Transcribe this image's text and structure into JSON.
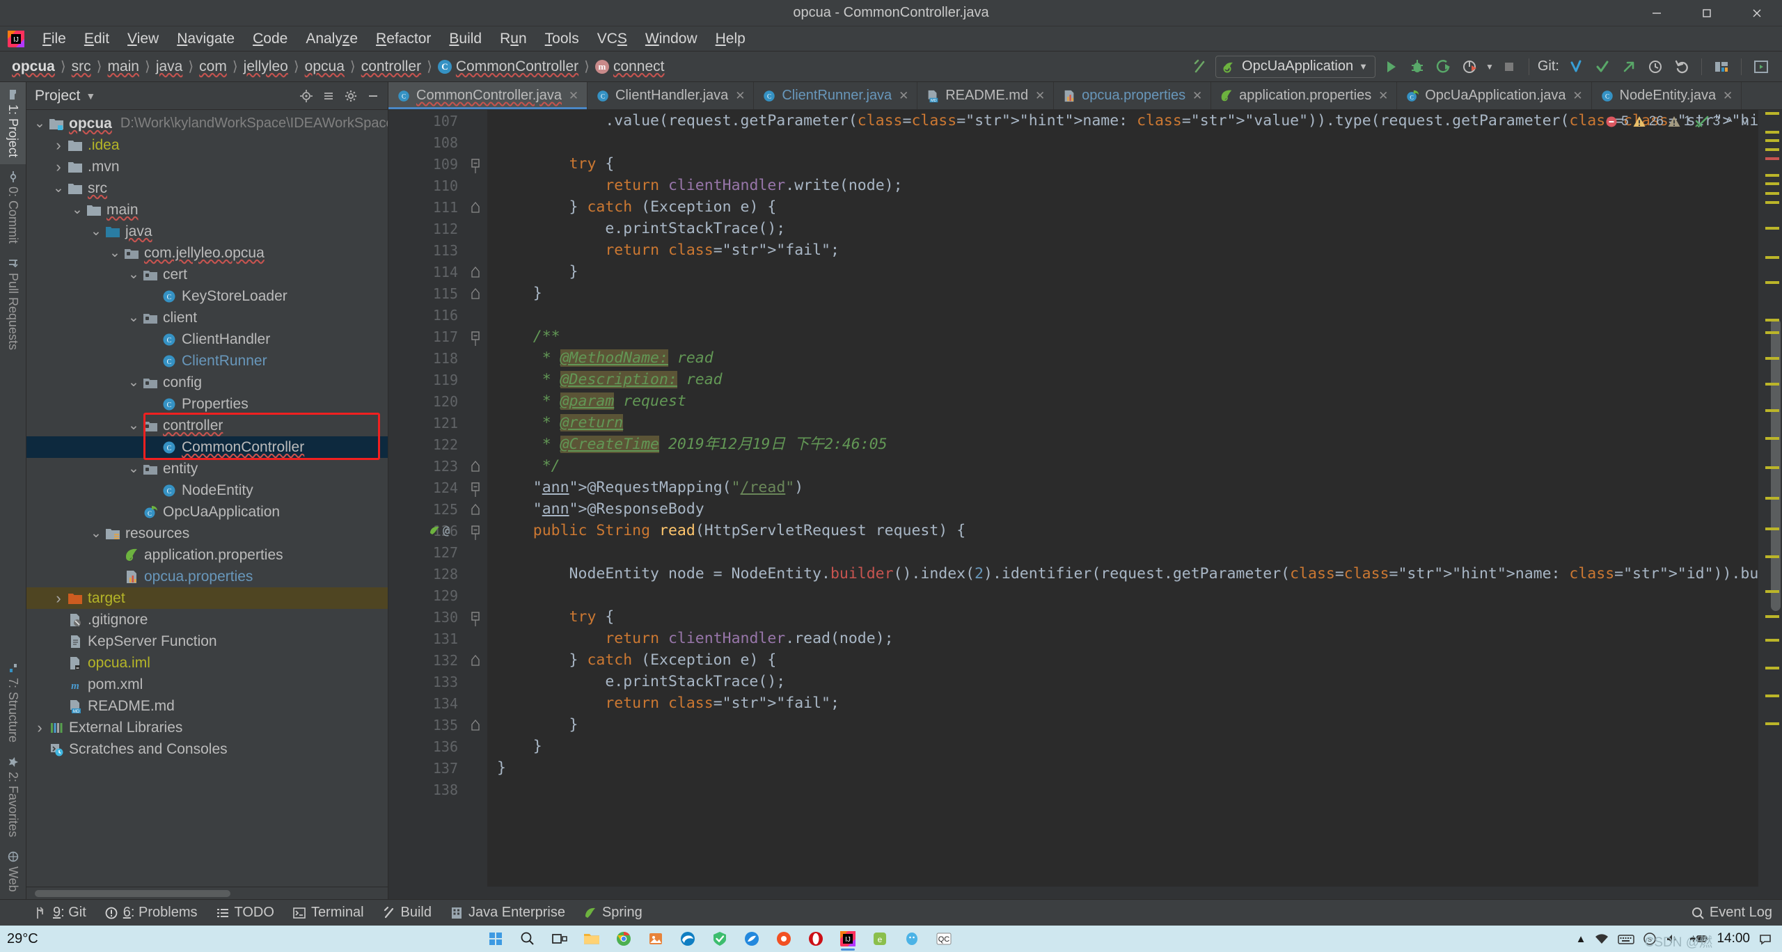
{
  "window": {
    "title": "opcua - CommonController.java",
    "minimize": "─",
    "maximize": "☐",
    "close": "✕"
  },
  "menu": {
    "items": [
      {
        "label": "File",
        "mnemonic": "F"
      },
      {
        "label": "Edit",
        "mnemonic": "E"
      },
      {
        "label": "View",
        "mnemonic": "V"
      },
      {
        "label": "Navigate",
        "mnemonic": "N"
      },
      {
        "label": "Code",
        "mnemonic": "C"
      },
      {
        "label": "Analyze",
        "mnemonic": "z"
      },
      {
        "label": "Refactor",
        "mnemonic": "R"
      },
      {
        "label": "Build",
        "mnemonic": "B"
      },
      {
        "label": "Run",
        "mnemonic": "u"
      },
      {
        "label": "Tools",
        "mnemonic": "T"
      },
      {
        "label": "VCS",
        "mnemonic": "S"
      },
      {
        "label": "Window",
        "mnemonic": "W"
      },
      {
        "label": "Help",
        "mnemonic": "H"
      }
    ]
  },
  "breadcrumbs": [
    {
      "label": "opcua",
      "bold": true,
      "spell": true,
      "icon": ""
    },
    {
      "label": "src",
      "bold": false,
      "spell": true,
      "icon": ""
    },
    {
      "label": "main",
      "bold": false,
      "spell": true,
      "icon": ""
    },
    {
      "label": "java",
      "bold": false,
      "spell": true,
      "icon": ""
    },
    {
      "label": "com",
      "bold": false,
      "spell": true,
      "icon": ""
    },
    {
      "label": "jellyleo",
      "bold": false,
      "spell": true,
      "icon": ""
    },
    {
      "label": "opcua",
      "bold": false,
      "spell": true,
      "icon": ""
    },
    {
      "label": "controller",
      "bold": false,
      "spell": true,
      "icon": ""
    },
    {
      "label": "CommonController",
      "bold": false,
      "spell": true,
      "icon": "class"
    },
    {
      "label": "connect",
      "bold": false,
      "spell": true,
      "icon": "method"
    }
  ],
  "toolbar": {
    "run_configuration": "OpcUaApplication",
    "git_label": "Git:",
    "icons": [
      "run-icon",
      "debug-icon",
      "run-with-coverage-icon",
      "profiler-icon",
      "stop-icon",
      "git-update-icon",
      "git-commit-icon",
      "git-push-icon",
      "git-history-icon",
      "git-rollback-icon",
      "search-everywhere-icon",
      "layout-icon"
    ]
  },
  "sidebar_left": {
    "top": [
      {
        "label": "1: Project",
        "mnemonic": "1",
        "active": true,
        "icon": "project-icon"
      },
      {
        "label": "0: Commit",
        "mnemonic": "0",
        "active": false,
        "icon": "commit-icon"
      },
      {
        "label": "Pull Requests",
        "mnemonic": "",
        "active": false,
        "icon": "pull-request-icon"
      }
    ],
    "bottom": [
      {
        "label": "7: Structure",
        "mnemonic": "7",
        "active": false,
        "icon": "structure-icon"
      },
      {
        "label": "2: Favorites",
        "mnemonic": "2",
        "active": false,
        "icon": "star-icon"
      },
      {
        "label": "Web",
        "mnemonic": "",
        "active": false,
        "icon": "web-icon"
      }
    ]
  },
  "project_panel": {
    "title": "Project",
    "header_icons": [
      "target-icon",
      "collapse-all-icon",
      "settings-gear-icon",
      "hide-icon"
    ],
    "tree": [
      {
        "depth": 0,
        "arrow": "down",
        "icon": "module-folder",
        "label": "opcua",
        "path": "D:\\Work\\kylandWorkSpace\\IDEAWorkSpace\\",
        "style": "bold",
        "spell": true
      },
      {
        "depth": 1,
        "arrow": "right",
        "icon": "folder",
        "label": ".idea",
        "path": "",
        "style": "yellow",
        "spell": false
      },
      {
        "depth": 1,
        "arrow": "right",
        "icon": "folder",
        "label": ".mvn",
        "path": "",
        "style": "",
        "spell": false
      },
      {
        "depth": 1,
        "arrow": "down",
        "icon": "folder",
        "label": "src",
        "path": "",
        "style": "",
        "spell": true
      },
      {
        "depth": 2,
        "arrow": "down",
        "icon": "folder",
        "label": "main",
        "path": "",
        "style": "",
        "spell": true
      },
      {
        "depth": 3,
        "arrow": "down",
        "icon": "source-folder",
        "label": "java",
        "path": "",
        "style": "",
        "spell": true
      },
      {
        "depth": 4,
        "arrow": "down",
        "icon": "package",
        "label": "com.jellyleo.opcua",
        "path": "",
        "style": "",
        "spell": true
      },
      {
        "depth": 5,
        "arrow": "down",
        "icon": "package",
        "label": "cert",
        "path": "",
        "style": "",
        "spell": false
      },
      {
        "depth": 6,
        "arrow": "none",
        "icon": "class",
        "label": "KeyStoreLoader",
        "path": "",
        "style": "",
        "spell": false
      },
      {
        "depth": 5,
        "arrow": "down",
        "icon": "package",
        "label": "client",
        "path": "",
        "style": "",
        "spell": false
      },
      {
        "depth": 6,
        "arrow": "none",
        "icon": "class",
        "label": "ClientHandler",
        "path": "",
        "style": "",
        "spell": false
      },
      {
        "depth": 6,
        "arrow": "none",
        "icon": "class",
        "label": "ClientRunner",
        "path": "",
        "style": "blue",
        "spell": false
      },
      {
        "depth": 5,
        "arrow": "down",
        "icon": "package",
        "label": "config",
        "path": "",
        "style": "",
        "spell": false
      },
      {
        "depth": 6,
        "arrow": "none",
        "icon": "class",
        "label": "Properties",
        "path": "",
        "style": "",
        "spell": false
      },
      {
        "depth": 5,
        "arrow": "down",
        "icon": "package",
        "label": "controller",
        "path": "",
        "style": "",
        "spell": true
      },
      {
        "depth": 6,
        "arrow": "none",
        "icon": "class",
        "label": "CommonController",
        "path": "",
        "style": "",
        "spell": true,
        "selected": true
      },
      {
        "depth": 5,
        "arrow": "down",
        "icon": "package",
        "label": "entity",
        "path": "",
        "style": "",
        "spell": false
      },
      {
        "depth": 6,
        "arrow": "none",
        "icon": "class",
        "label": "NodeEntity",
        "path": "",
        "style": "",
        "spell": false
      },
      {
        "depth": 5,
        "arrow": "none",
        "icon": "spring-class",
        "label": "OpcUaApplication",
        "path": "",
        "style": "",
        "spell": false
      },
      {
        "depth": 3,
        "arrow": "down",
        "icon": "resource-folder",
        "label": "resources",
        "path": "",
        "style": "",
        "spell": false
      },
      {
        "depth": 4,
        "arrow": "none",
        "icon": "spring-props",
        "label": "application.properties",
        "path": "",
        "style": "",
        "spell": false
      },
      {
        "depth": 4,
        "arrow": "none",
        "icon": "properties",
        "label": "opcua.properties",
        "path": "",
        "style": "blue",
        "spell": false
      },
      {
        "depth": 1,
        "arrow": "right",
        "icon": "target-folder",
        "label": "target",
        "path": "",
        "style": "yellow",
        "spell": false,
        "highlight": true
      },
      {
        "depth": 1,
        "arrow": "none",
        "icon": "gitignore",
        "label": ".gitignore",
        "path": "",
        "style": "",
        "spell": false
      },
      {
        "depth": 1,
        "arrow": "none",
        "icon": "text-file",
        "label": "KepServer Function",
        "path": "",
        "style": "",
        "spell": false
      },
      {
        "depth": 1,
        "arrow": "none",
        "icon": "iml-file",
        "label": "opcua.iml",
        "path": "",
        "style": "yellow",
        "spell": false
      },
      {
        "depth": 1,
        "arrow": "none",
        "icon": "maven",
        "label": "pom.xml",
        "path": "",
        "style": "",
        "spell": false
      },
      {
        "depth": 1,
        "arrow": "none",
        "icon": "markdown",
        "label": "README.md",
        "path": "",
        "style": "",
        "spell": false
      },
      {
        "depth": 0,
        "arrow": "right",
        "icon": "libraries",
        "label": "External Libraries",
        "path": "",
        "style": "",
        "spell": false
      },
      {
        "depth": 0,
        "arrow": "none",
        "icon": "scratches",
        "label": "Scratches and Consoles",
        "path": "",
        "style": "",
        "spell": false
      }
    ]
  },
  "editor_tabs": [
    {
      "label": "CommonController.java",
      "icon": "class",
      "active": true,
      "spell": true,
      "blue": false
    },
    {
      "label": "ClientHandler.java",
      "icon": "class",
      "active": false,
      "spell": false,
      "blue": false
    },
    {
      "label": "ClientRunner.java",
      "icon": "class",
      "active": false,
      "spell": false,
      "blue": true
    },
    {
      "label": "README.md",
      "icon": "markdown",
      "active": false,
      "spell": false,
      "blue": false
    },
    {
      "label": "opcua.properties",
      "icon": "properties",
      "active": false,
      "spell": false,
      "blue": true
    },
    {
      "label": "application.properties",
      "icon": "spring-props",
      "active": false,
      "spell": false,
      "blue": false
    },
    {
      "label": "OpcUaApplication.java",
      "icon": "spring-class",
      "active": false,
      "spell": false,
      "blue": false
    },
    {
      "label": "NodeEntity.java",
      "icon": "class",
      "active": false,
      "spell": false,
      "blue": false
    }
  ],
  "editor": {
    "first_line_number": 107,
    "last_line_number": 138,
    "inspections": {
      "errors": "5",
      "warnings": "26",
      "weak_warnings": "1",
      "typos": "3",
      "up_arrow": "⌃",
      "down_arrow": "⌄"
    },
    "code_lines": [
      {
        "n": 107,
        "fold": "",
        "gutter": "",
        "text": "            .value(request.getParameter( name: \"value\")).type(request.getParameter( name: \"type\")).build();"
      },
      {
        "n": 108,
        "fold": "",
        "gutter": "",
        "text": ""
      },
      {
        "n": 109,
        "fold": "open",
        "gutter": "",
        "text": "        try {"
      },
      {
        "n": 110,
        "fold": "",
        "gutter": "",
        "text": "            return clientHandler.write(node);"
      },
      {
        "n": 111,
        "fold": "end",
        "gutter": "",
        "text": "        } catch (Exception e) {"
      },
      {
        "n": 112,
        "fold": "",
        "gutter": "",
        "text": "            e.printStackTrace();"
      },
      {
        "n": 113,
        "fold": "",
        "gutter": "",
        "text": "            return \"fail\";"
      },
      {
        "n": 114,
        "fold": "end",
        "gutter": "",
        "text": "        }"
      },
      {
        "n": 115,
        "fold": "end",
        "gutter": "",
        "text": "    }"
      },
      {
        "n": 116,
        "fold": "",
        "gutter": "",
        "text": ""
      },
      {
        "n": 117,
        "fold": "open",
        "gutter": "",
        "text": "    /**"
      },
      {
        "n": 118,
        "fold": "",
        "gutter": "",
        "text": "     * @MethodName: read"
      },
      {
        "n": 119,
        "fold": "",
        "gutter": "",
        "text": "     * @Description: read"
      },
      {
        "n": 120,
        "fold": "",
        "gutter": "",
        "text": "     * @param request"
      },
      {
        "n": 121,
        "fold": "",
        "gutter": "",
        "text": "     * @return"
      },
      {
        "n": 122,
        "fold": "",
        "gutter": "",
        "text": "     * @CreateTime 2019年12月19日 下午2:46:05"
      },
      {
        "n": 123,
        "fold": "end",
        "gutter": "",
        "text": "     */"
      },
      {
        "n": 124,
        "fold": "open",
        "gutter": "",
        "text": "    @RequestMapping(\"/read\")"
      },
      {
        "n": 125,
        "fold": "end",
        "gutter": "",
        "text": "    @ResponseBody"
      },
      {
        "n": 126,
        "fold": "open",
        "gutter": "spring",
        "text": "    public String read(HttpServletRequest request) {"
      },
      {
        "n": 127,
        "fold": "",
        "gutter": "",
        "text": ""
      },
      {
        "n": 128,
        "fold": "",
        "gutter": "",
        "text": "        NodeEntity node = NodeEntity.builder().index(2).identifier(request.getParameter( name: \"id\")).build();"
      },
      {
        "n": 129,
        "fold": "",
        "gutter": "",
        "text": ""
      },
      {
        "n": 130,
        "fold": "open",
        "gutter": "",
        "text": "        try {"
      },
      {
        "n": 131,
        "fold": "",
        "gutter": "",
        "text": "            return clientHandler.read(node);"
      },
      {
        "n": 132,
        "fold": "end",
        "gutter": "",
        "text": "        } catch (Exception e) {"
      },
      {
        "n": 133,
        "fold": "",
        "gutter": "",
        "text": "            e.printStackTrace();"
      },
      {
        "n": 134,
        "fold": "",
        "gutter": "",
        "text": "            return \"fail\";"
      },
      {
        "n": 135,
        "fold": "end",
        "gutter": "",
        "text": "        }"
      },
      {
        "n": 136,
        "fold": "",
        "gutter": "",
        "text": "    }"
      },
      {
        "n": 137,
        "fold": "",
        "gutter": "",
        "text": "}"
      },
      {
        "n": 138,
        "fold": "",
        "gutter": "",
        "text": ""
      }
    ]
  },
  "bottom_bar": {
    "tools": [
      {
        "label": "9: Git",
        "mnemonic": "9",
        "icon": "git-branch-icon"
      },
      {
        "label": "6: Problems",
        "mnemonic": "6",
        "icon": "problems-icon"
      },
      {
        "label": "TODO",
        "mnemonic": "",
        "icon": "todo-icon"
      },
      {
        "label": "Terminal",
        "mnemonic": "",
        "icon": "terminal-icon"
      },
      {
        "label": "Build",
        "mnemonic": "",
        "icon": "build-hammer-icon"
      },
      {
        "label": "Java Enterprise",
        "mnemonic": "",
        "icon": "java-enterprise-icon"
      },
      {
        "label": "Spring",
        "mnemonic": "",
        "icon": "spring-leaf-icon"
      }
    ],
    "event_log": "Event Log",
    "event_log_icon": "event-log-icon"
  },
  "taskbar": {
    "temperature": "29°C",
    "clock": "14:00",
    "watermark": "CSDN @燃",
    "apps": [
      "start-icon",
      "search-icon",
      "task-view-icon",
      "file-explorer-icon",
      "chrome-icon",
      "photos-icon",
      "edge-icon",
      "security-icon",
      "explorer2-icon",
      "browser-icon",
      "opera-icon",
      "intellij-icon",
      "app-icon",
      "qq-icon",
      "qc-icon"
    ],
    "tray": [
      "chevron-up-icon",
      "network-icon",
      "keyboard-icon",
      "input-icon",
      "volume-icon",
      "battery-icon",
      "notification-icon"
    ]
  }
}
